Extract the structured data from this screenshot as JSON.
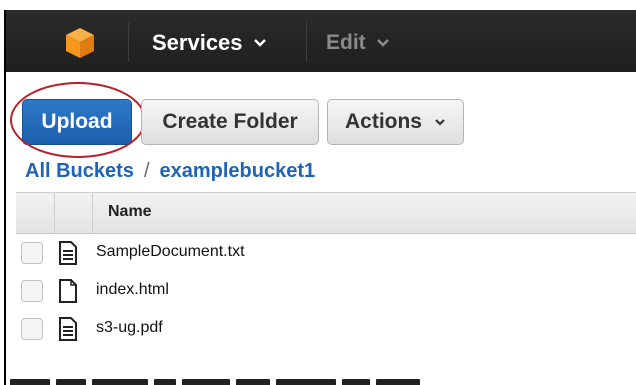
{
  "header": {
    "services_label": "Services",
    "edit_label": "Edit"
  },
  "toolbar": {
    "upload_label": "Upload",
    "create_folder_label": "Create Folder",
    "actions_label": "Actions"
  },
  "breadcrumb": {
    "root": "All Buckets",
    "separator": "/",
    "bucket": "examplebucket1"
  },
  "table": {
    "name_header": "Name",
    "rows": [
      {
        "name": "SampleDocument.txt",
        "icon": "text-file-icon"
      },
      {
        "name": "index.html",
        "icon": "blank-file-icon"
      },
      {
        "name": "s3-ug.pdf",
        "icon": "text-file-icon"
      }
    ]
  },
  "colors": {
    "header_bg": "#232323",
    "primary_blue": "#1f63b6",
    "highlight_red": "#b5202a",
    "cube_orange": "#f7981d"
  }
}
